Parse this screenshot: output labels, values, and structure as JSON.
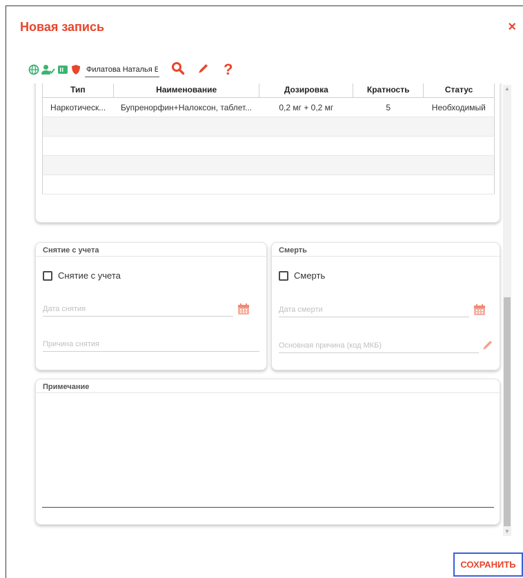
{
  "dialog": {
    "title": "Новая запись",
    "close_label": "×"
  },
  "toolbar": {
    "patient_name": "Филатова Наталья Е",
    "help_label": "?"
  },
  "colors": {
    "accent": "#e8452c",
    "icon_green": "#3cb371",
    "save_border": "#3561d9"
  },
  "table": {
    "columns": [
      "Тип",
      "Наименование",
      "Дозировка",
      "Кратность",
      "Статус"
    ],
    "rows": [
      {
        "type": "Наркотическ...",
        "name": "Бупренорфин+Налоксон, таблет...",
        "dose": "0,2 мг + 0,2 мг",
        "frequency": "5",
        "status": "Необходимый"
      }
    ]
  },
  "deregistration": {
    "header": "Снятие с учета",
    "checkbox_label": "Снятие с учета",
    "date_placeholder": "Дата снятия",
    "reason_placeholder": "Причина снятия"
  },
  "death": {
    "header": "Смерть",
    "checkbox_label": "Смерть",
    "date_placeholder": "Дата смерти",
    "cause_placeholder": "Основная причина (код МКБ)"
  },
  "note": {
    "header": "Примечание"
  },
  "actions": {
    "save_label": "СОХРАНИТЬ"
  }
}
